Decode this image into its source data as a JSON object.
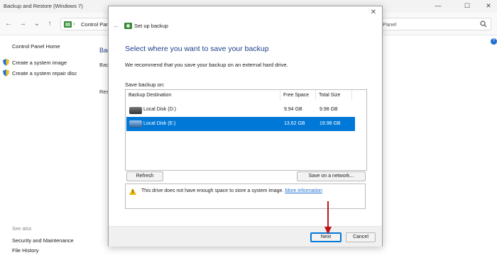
{
  "window": {
    "title": "Backup and Restore (Windows 7)",
    "controls": {
      "minimize": "—",
      "maximize": "☐",
      "close": "✕"
    }
  },
  "addressbar": {
    "back": "←",
    "forward": "→",
    "recent": "⌄",
    "up": "↑",
    "breadcrumb_root": "Control Panel",
    "separator": "›",
    "search_text": "Panel",
    "help": "?"
  },
  "sidebar": {
    "home": "Control Panel Home",
    "links": [
      "Create a system image",
      "Create a system repair disc"
    ],
    "see_also": "See also",
    "see_also_links": [
      "Security and Maintenance",
      "File History"
    ]
  },
  "background_fragments": [
    "Bac",
    "Bac",
    "Rest"
  ],
  "dialog": {
    "title": "Set up backup",
    "close": "✕",
    "back": "←",
    "heading": "Select where you want to save your backup",
    "recommend": "We recommend that you save your backup on an external hard drive.",
    "save_on_label": "Save backup on:",
    "columns": [
      "Backup Destination",
      "Free Space",
      "Total Size"
    ],
    "rows": [
      {
        "name": "Local Disk (D:)",
        "free": "9.94 GB",
        "total": "9.98 GB"
      },
      {
        "name": "Local Disk (E:)",
        "free": "13.62 GB",
        "total": "19.98 GB"
      }
    ],
    "selected_row": 1,
    "refresh_label": "Refresh",
    "network_label": "Save on a network...",
    "warning_text": "This drive does not have enough space to store a system image.",
    "warning_link": "More information",
    "next_label": "Next",
    "cancel_label": "Cancel"
  },
  "colors": {
    "accent": "#0078d7",
    "heading": "#1e3f8a",
    "link": "#1f6fd1",
    "warning": "#e9b500",
    "annotation_arrow": "#c0141c"
  }
}
